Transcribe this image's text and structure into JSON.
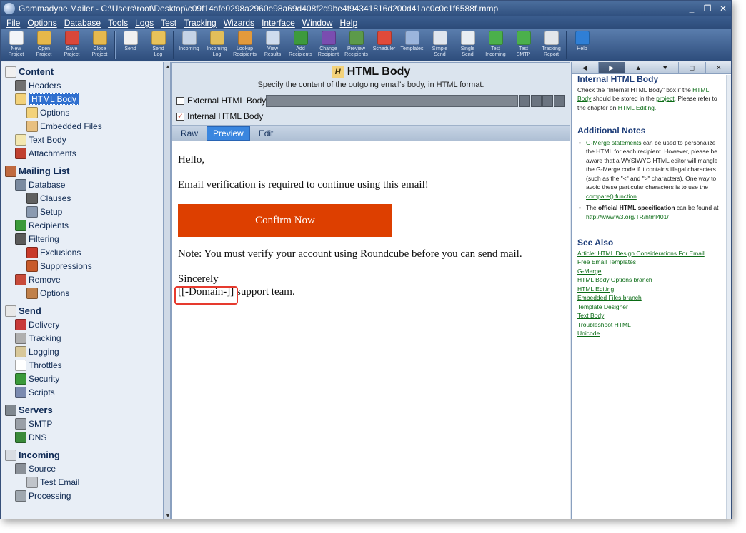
{
  "window": {
    "title": "Gammadyne Mailer - C:\\Users\\root\\Desktop\\c09f14afe0298a2960e98a69d408f2d9be4f94341816d200d41ac0c0c1f6588f.mmp",
    "controls": [
      "_",
      "❐",
      "✕"
    ]
  },
  "menu": [
    "File",
    "Options",
    "Database",
    "Tools",
    "Logs",
    "Test",
    "Tracking",
    "Wizards",
    "Interface",
    "Window",
    "Help"
  ],
  "toolbar": [
    {
      "label": "New\nProject",
      "icon": "new-project-icon",
      "color": "#f2f4f8"
    },
    {
      "label": "Open\nProject",
      "icon": "open-project-icon",
      "color": "#e7b84a"
    },
    {
      "label": "Save\nProject",
      "icon": "save-project-icon",
      "color": "#d9473a"
    },
    {
      "label": "Close\nProject",
      "icon": "close-project-icon",
      "color": "#e6b94e"
    },
    {
      "sep": true
    },
    {
      "label": "Send",
      "icon": "send-icon",
      "color": "#f1f1f1"
    },
    {
      "label": "Send\nLog",
      "icon": "send-log-icon",
      "color": "#e8c25a"
    },
    {
      "sep": true
    },
    {
      "label": "Incoming",
      "icon": "incoming-icon",
      "color": "#c5d3e6"
    },
    {
      "label": "Incoming\nLog",
      "icon": "incoming-log-icon",
      "color": "#e2be5a"
    },
    {
      "label": "Lookup\nRecipients",
      "icon": "lookup-recipients-icon",
      "color": "#e39a3c"
    },
    {
      "label": "View\nResults",
      "icon": "view-results-icon",
      "color": "#cfdcee"
    },
    {
      "label": "Add\nRecipients",
      "icon": "add-recipients-icon",
      "color": "#3d9a3d"
    },
    {
      "label": "Change\nRecipient",
      "icon": "change-recipient-icon",
      "color": "#7a4db0"
    },
    {
      "label": "Preview\nRecipients",
      "icon": "preview-recipients-icon",
      "color": "#5c9a4a"
    },
    {
      "label": "Scheduler",
      "icon": "scheduler-icon",
      "color": "#e04a3a"
    },
    {
      "label": "Templates",
      "icon": "templates-icon",
      "color": "#9bb5dc"
    },
    {
      "label": "Simple\nSend",
      "icon": "simple-send-icon",
      "color": "#e0e6ee"
    },
    {
      "label": "Single\nSend",
      "icon": "single-send-icon",
      "color": "#e9eef3"
    },
    {
      "label": "Test\nIncoming",
      "icon": "test-incoming-icon",
      "color": "#4bb04b"
    },
    {
      "label": "Test\nSMTP",
      "icon": "test-smtp-icon",
      "color": "#4bb04b"
    },
    {
      "label": "Tracking\nReport",
      "icon": "tracking-report-icon",
      "color": "#e2e6ea"
    },
    {
      "sep": true
    },
    {
      "label": "Help",
      "icon": "help-icon",
      "color": "#2f7fd6"
    }
  ],
  "tree": [
    {
      "label": "Content",
      "level": 0,
      "section": true,
      "icon": "content-icon",
      "color": "#f0f0f0"
    },
    {
      "label": "Headers",
      "level": 1,
      "icon": "headers-icon",
      "color": "#707070"
    },
    {
      "label": "HTML Body",
      "level": 1,
      "icon": "html-body-icon",
      "color": "#f3d27a",
      "selected": true
    },
    {
      "label": "Options",
      "level": 2,
      "icon": "options-icon",
      "color": "#f3d27a"
    },
    {
      "label": "Embedded Files",
      "level": 2,
      "icon": "embedded-files-icon",
      "color": "#e8c080"
    },
    {
      "label": "Text Body",
      "level": 1,
      "icon": "text-body-icon",
      "color": "#f3e7b0"
    },
    {
      "label": "Attachments",
      "level": 1,
      "icon": "attachments-icon",
      "color": "#c04030"
    },
    {
      "label": "Mailing List",
      "level": 0,
      "section": true,
      "icon": "mailing-list-icon",
      "color": "#c06a40"
    },
    {
      "label": "Database",
      "level": 1,
      "icon": "database-icon",
      "color": "#7a8aa0"
    },
    {
      "label": "Clauses",
      "level": 2,
      "icon": "clauses-icon",
      "color": "#606060"
    },
    {
      "label": "Setup",
      "level": 2,
      "icon": "setup-icon",
      "color": "#8a9ab0"
    },
    {
      "label": "Recipients",
      "level": 1,
      "icon": "recipients-icon",
      "color": "#3a9a3a"
    },
    {
      "label": "Filtering",
      "level": 1,
      "icon": "filtering-icon",
      "color": "#5a5a5a"
    },
    {
      "label": "Exclusions",
      "level": 2,
      "icon": "exclusions-icon",
      "color": "#c83a2a"
    },
    {
      "label": "Suppressions",
      "level": 2,
      "icon": "suppressions-icon",
      "color": "#c85a2a"
    },
    {
      "label": "Remove",
      "level": 1,
      "icon": "remove-icon",
      "color": "#c84a3a"
    },
    {
      "label": "Options",
      "level": 2,
      "icon": "remove-options-icon",
      "color": "#c0804a"
    },
    {
      "label": "Send",
      "level": 0,
      "section": true,
      "icon": "send-section-icon",
      "color": "#e8e8e8"
    },
    {
      "label": "Delivery",
      "level": 1,
      "icon": "delivery-icon",
      "color": "#c83a3a"
    },
    {
      "label": "Tracking",
      "level": 1,
      "icon": "tracking-icon",
      "color": "#b0b0b0"
    },
    {
      "label": "Logging",
      "level": 1,
      "icon": "logging-icon",
      "color": "#d8c89a"
    },
    {
      "label": "Throttles",
      "level": 1,
      "icon": "throttles-icon",
      "color": "#ffffff"
    },
    {
      "label": "Security",
      "level": 1,
      "icon": "security-icon",
      "color": "#3a9a3a"
    },
    {
      "label": "Scripts",
      "level": 1,
      "icon": "scripts-icon",
      "color": "#7a8ab0"
    },
    {
      "label": "Servers",
      "level": 0,
      "section": true,
      "icon": "servers-icon",
      "color": "#808890"
    },
    {
      "label": "SMTP",
      "level": 1,
      "icon": "smtp-icon",
      "color": "#9aa0a8"
    },
    {
      "label": "DNS",
      "level": 1,
      "icon": "dns-icon",
      "color": "#3a8a3a"
    },
    {
      "label": "Incoming",
      "level": 0,
      "section": true,
      "icon": "incoming-section-icon",
      "color": "#d8dce2"
    },
    {
      "label": "Source",
      "level": 1,
      "icon": "source-icon",
      "color": "#8a9098"
    },
    {
      "label": "Test Email",
      "level": 2,
      "icon": "test-email-icon",
      "color": "#c0c4ca"
    },
    {
      "label": "Processing",
      "level": 1,
      "icon": "processing-icon",
      "color": "#a0a8b0"
    }
  ],
  "editor": {
    "title": "HTML Body",
    "icon_letter": "H",
    "description": "Specify the content of the outgoing email's body, in HTML format.",
    "external_label": "External HTML Body:",
    "external_checked": false,
    "internal_label": "Internal HTML Body",
    "internal_checked": true,
    "tabs": [
      "Raw",
      "Preview",
      "Edit"
    ],
    "active_tab": "Preview"
  },
  "preview": {
    "greeting": "Hello,",
    "line1": "Email verification is required to continue using this email!",
    "button": "Confirm Now",
    "button_color": "#dd3f00",
    "note": "Note: You must verify your account using Roundcube before you can send mail.",
    "sincerely": "Sincerely",
    "domain": "[[-Domain-]]",
    "signature_rest": " support team."
  },
  "help": {
    "nav": [
      "◀",
      "▶",
      "▲",
      "▼",
      "◻",
      "✕"
    ],
    "heading": "Internal HTML Body",
    "intro_1": "Check the \"Internal HTML Body\" box if the ",
    "intro_link1": "HTML Body",
    "intro_2": " should be stored in the ",
    "intro_link2": "project",
    "intro_3": ".  Please refer to the chapter on ",
    "intro_link3": "HTML Editing",
    "intro_4": ".",
    "notes_heading": "Additional Notes",
    "note1_link": "G-Merge statements",
    "note1_text": " can be used to personalize the HTML for each recipient. However, please be aware that a WYSIWYG HTML editor will mangle the G-Merge code if it contains illegal characters (such as the \"<\" and \">\" characters).  One way to avoid these particular characters is to use the ",
    "note1_link2": "compare() function",
    "note1_end": ".",
    "note2_pre": "The ",
    "note2_bold": "official HTML specification",
    "note2_mid": " can be found at ",
    "note2_link": "http://www.w3.org/TR/html401/",
    "see_also_heading": "See Also",
    "see_also": [
      "Article: HTML Design Considerations For Email",
      "Free Email Templates",
      "G-Merge",
      "HTML Body Options branch",
      "HTML Editing",
      "Embedded Files branch",
      "Template Designer",
      "Text Body",
      "Troubleshoot HTML",
      "Unicode"
    ]
  }
}
